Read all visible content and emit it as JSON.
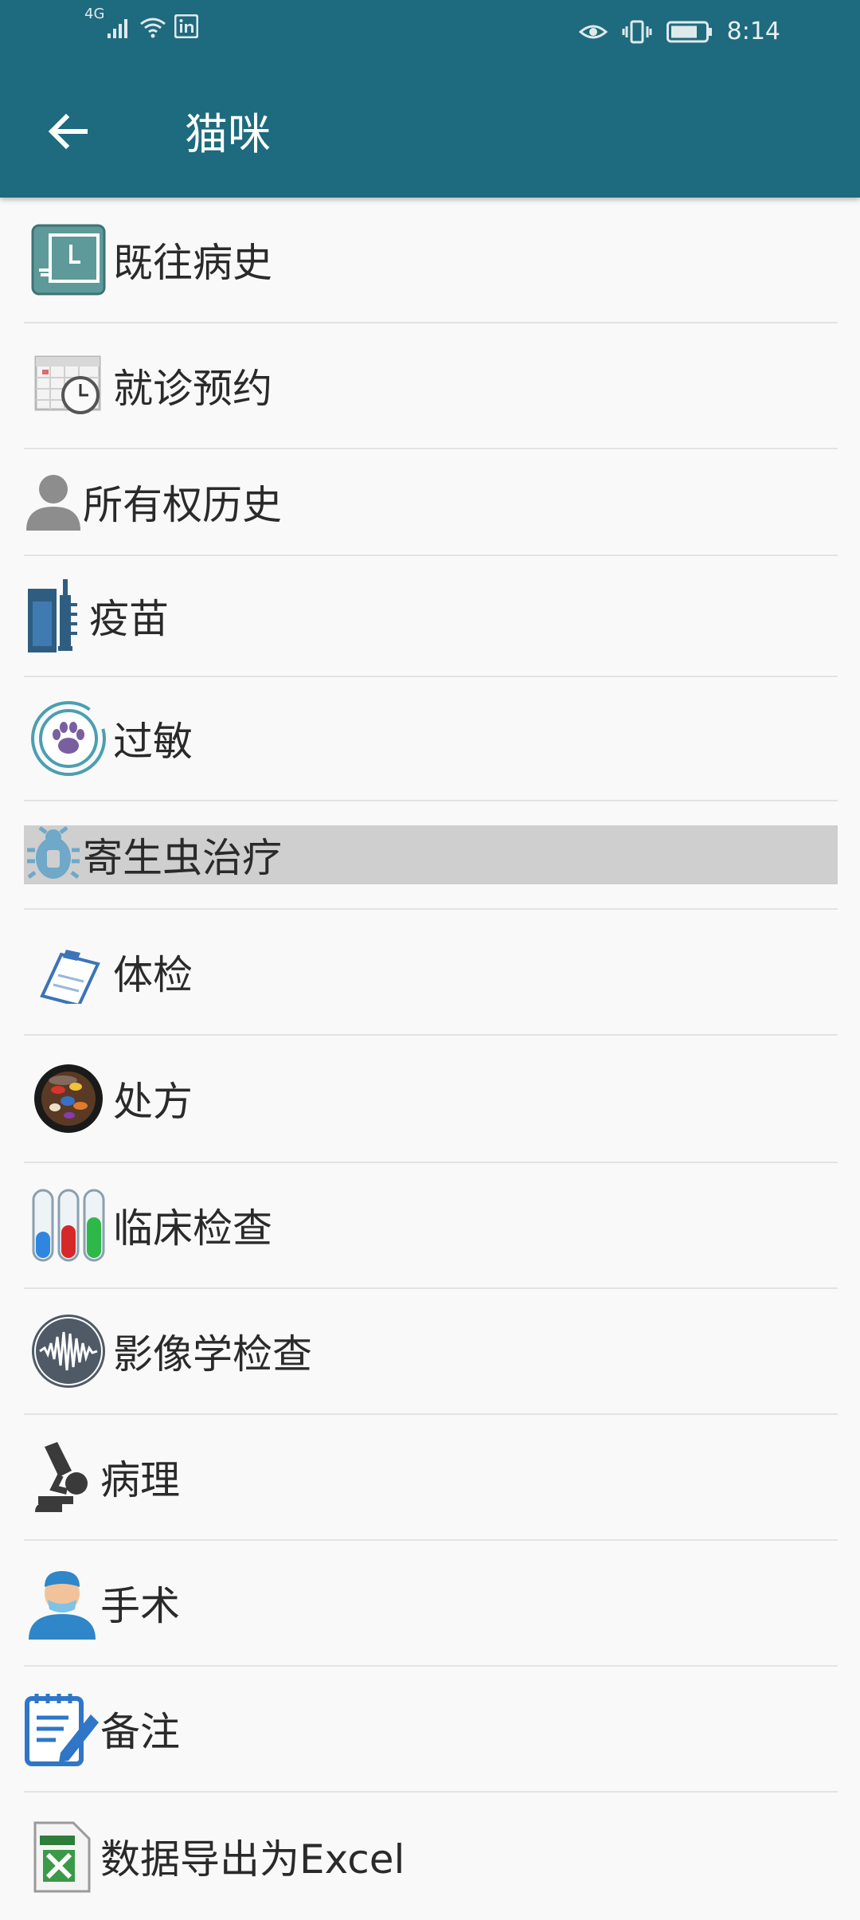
{
  "status_bar": {
    "network": "4G",
    "time": "8:14"
  },
  "toolbar": {
    "back_icon": "arrow-left-icon",
    "title": "猫咪"
  },
  "menu": [
    {
      "label": "既往病史",
      "icon": "history-icon"
    },
    {
      "label": "就诊预约",
      "icon": "calendar-clock-icon"
    },
    {
      "label": "所有权历史",
      "icon": "person-icon"
    },
    {
      "label": "疫苗",
      "icon": "vaccine-syringe-icon"
    },
    {
      "label": "过敏",
      "icon": "paw-icon"
    },
    {
      "label": "寄生虫治疗",
      "icon": "bug-icon"
    },
    {
      "label": "体检",
      "icon": "clipboard-icon"
    },
    {
      "label": "处方",
      "icon": "pills-icon"
    },
    {
      "label": "临床检查",
      "icon": "test-tubes-icon"
    },
    {
      "label": "影像学检查",
      "icon": "waveform-icon"
    },
    {
      "label": "病理",
      "icon": "microscope-icon"
    },
    {
      "label": "手术",
      "icon": "surgeon-icon"
    },
    {
      "label": "备注",
      "icon": "notepad-icon"
    },
    {
      "label": "数据导出为Excel",
      "icon": "excel-icon"
    }
  ],
  "colors": {
    "toolbar": "#1e6a7e",
    "highlight_row": "#cfcfcf"
  }
}
